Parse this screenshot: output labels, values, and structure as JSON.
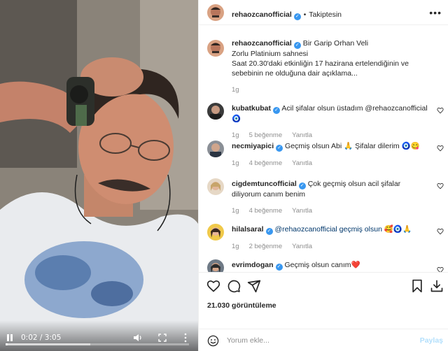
{
  "video": {
    "time": "0:02 / 3:05",
    "progress_fraction": 0.011,
    "buffered_fraction": 0.46,
    "icons": [
      "pause-icon",
      "volume-icon",
      "fullscreen-icon",
      "more-vertical-icon"
    ]
  },
  "header": {
    "username": "rehaozcanofficial",
    "verified_mark": "✓",
    "dot": "•",
    "follow_label": "Takiptesin",
    "more": "•••"
  },
  "caption": {
    "username": "rehaozcanofficial",
    "line1_rest": "Bir Garip Orhan Veli",
    "line2": "Zorlu Platinium sahnesi",
    "line3": "Saat 20.30'daki etkinliğin 17 hazirana ertelendiğinin ve sebebinin ne olduğuna dair açıklama...",
    "time": "1g"
  },
  "comments": [
    {
      "username": "kubatkubat",
      "text": "Acil şifalar olsun üstadım @rehaozcanofficial",
      "emoji": "🧿",
      "time": "1g",
      "likes": "5 beğenme",
      "reply": "Yanıtla"
    },
    {
      "username": "necmiyapici",
      "text": "Geçmiş olsun Abi 🙏 Şifalar dilerim",
      "emoji": "🧿😋",
      "time": "1g",
      "likes": "4 beğenme",
      "reply": "Yanıtla"
    },
    {
      "username": "cigdemtuncofficial",
      "text": "Çok geçmiş olsun acil şifalar diliyorum canım benim",
      "emoji": "",
      "time": "1g",
      "likes": "4 beğenme",
      "reply": "Yanıtla"
    },
    {
      "username": "hilalsaral",
      "text": "@rehaozcanofficial geçmiş olsun",
      "emoji": "🥰🧿🙏",
      "time": "1g",
      "likes": "2 beğenme",
      "reply": "Yanıtla"
    },
    {
      "username": "evrimdogan",
      "text": "Geçmiş olsun canım",
      "emoji": "❤️",
      "time": "",
      "likes": "",
      "reply": ""
    }
  ],
  "actions": {
    "views": "21.030 görüntüleme"
  },
  "add_comment": {
    "placeholder": "Yorum ekle...",
    "post_label": "Paylaş"
  },
  "colors": {
    "verified": "#3897f0",
    "link": "#00376b",
    "muted": "#8e8e8e",
    "post_disabled": "#b2dffc",
    "heart": "#ed4956"
  }
}
